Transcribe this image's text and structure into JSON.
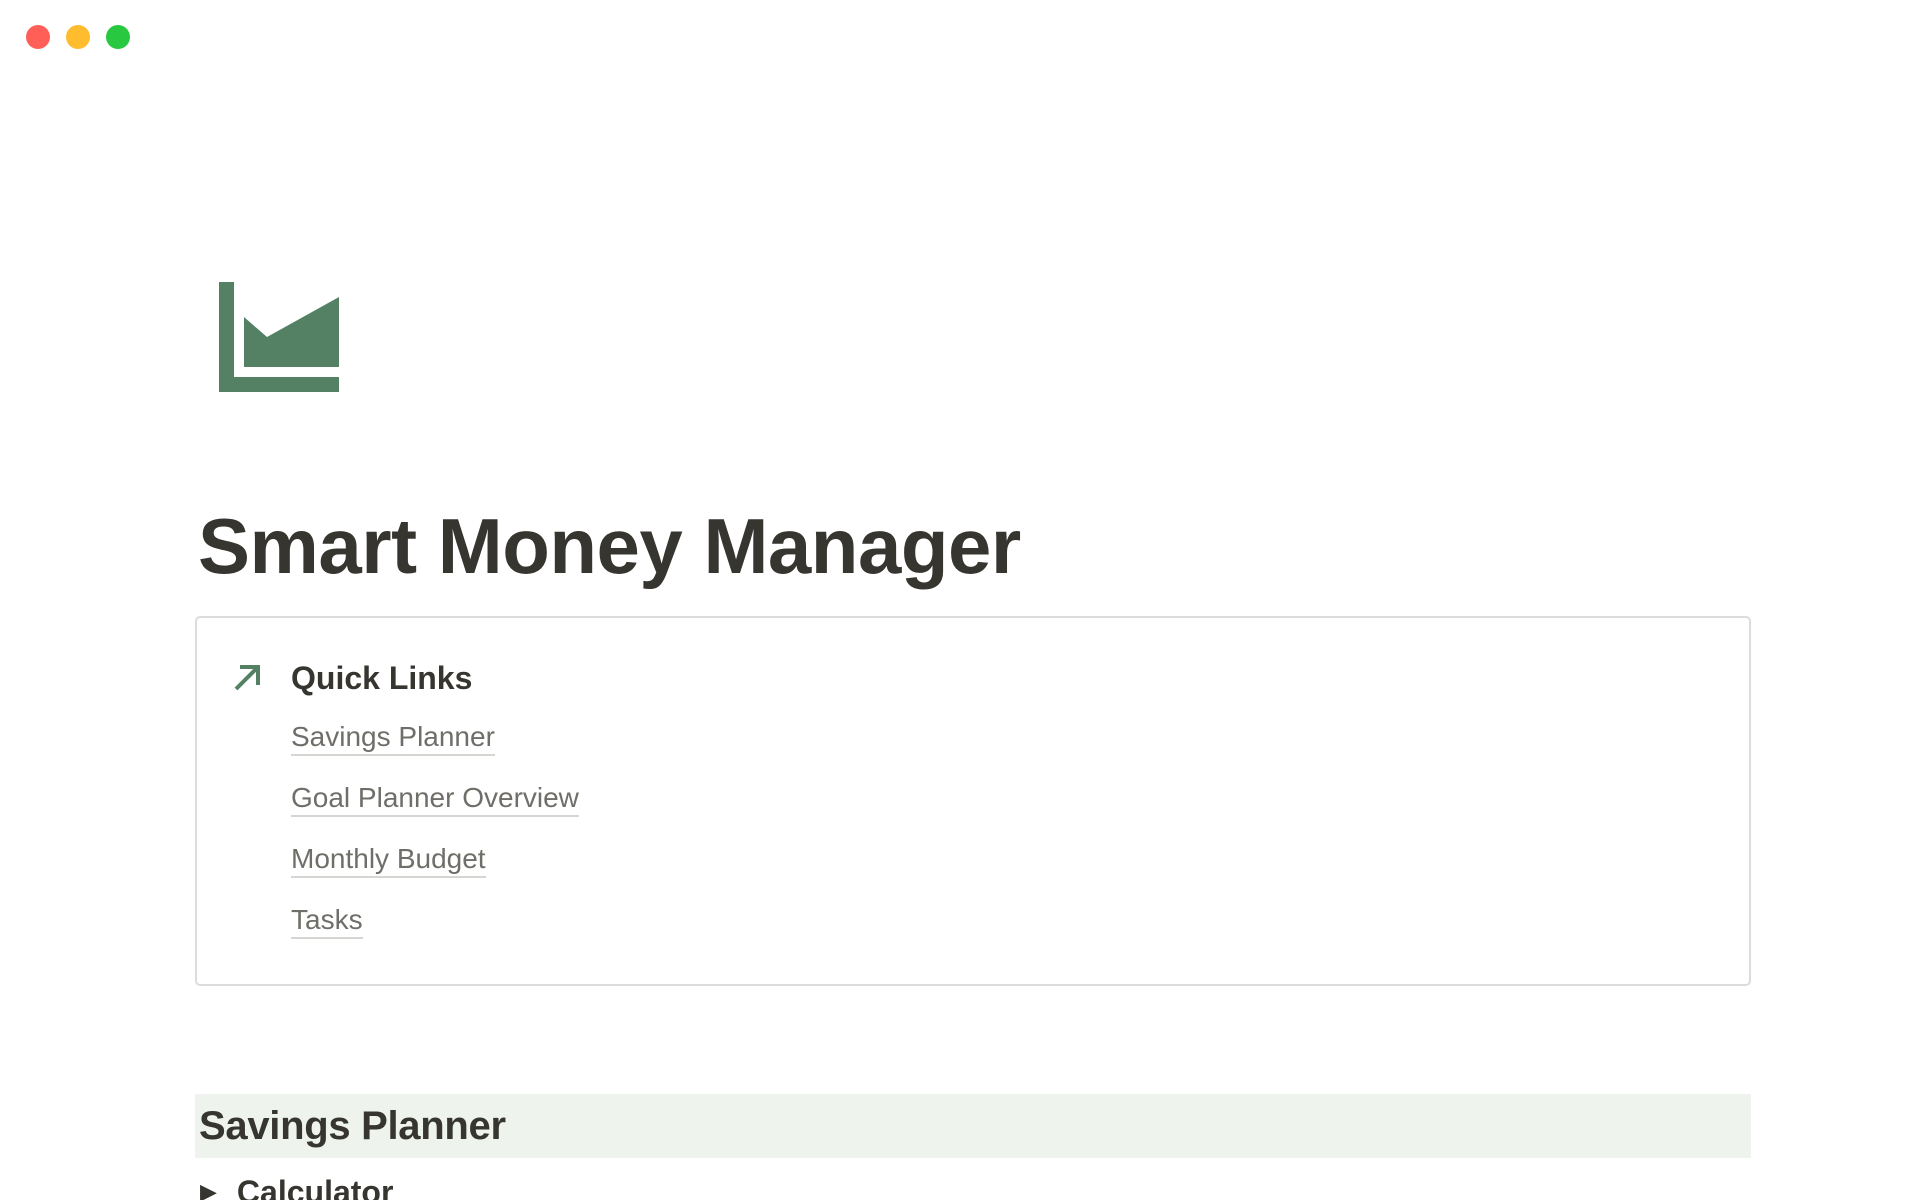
{
  "window": {
    "controls": {
      "close_color": "#ff5f57",
      "minimize_color": "#febc2e",
      "zoom_color": "#28c840"
    }
  },
  "page": {
    "icon": "area-chart-icon",
    "icon_color": "#548164",
    "title": "Smart Money Manager"
  },
  "quick_links": {
    "icon": "arrow-up-right-icon",
    "heading": "Quick Links",
    "links": [
      {
        "label": "Savings Planner"
      },
      {
        "label": "Goal Planner Overview"
      },
      {
        "label": "Monthly Budget"
      },
      {
        "label": "Tasks"
      }
    ]
  },
  "savings_section": {
    "heading": "Savings Planner",
    "background": "#eef3ee",
    "toggle": {
      "icon": "triangle-right-icon",
      "label": "Calculator"
    }
  }
}
